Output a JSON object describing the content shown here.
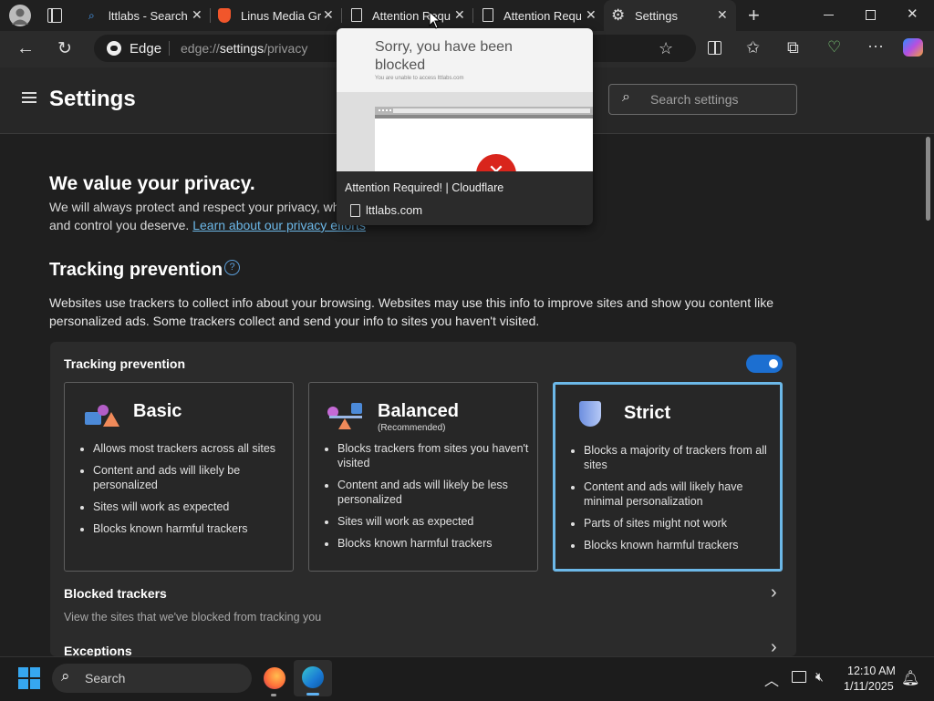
{
  "tabs": [
    {
      "title": "lttlabs - Search",
      "icon": "bing-search-icon"
    },
    {
      "title": "Linus Media Gr",
      "icon": "brave-lion-icon"
    },
    {
      "title": "Attention Requ",
      "icon": "page-icon"
    },
    {
      "title": "Attention Requ",
      "icon": "page-icon"
    },
    {
      "title": "Settings",
      "icon": "gear-icon"
    }
  ],
  "toolbar": {
    "browser_label": "Edge",
    "url_prefix": "edge://",
    "url_path": "settings",
    "url_suffix": "/privacy"
  },
  "settings": {
    "title": "Settings",
    "search_placeholder": "Search settings"
  },
  "privacy": {
    "heading": "We value your privacy.",
    "body_line1": "We will always protect and respect your privacy, wh",
    "body_line2": "and control you deserve.",
    "link": "Learn about our privacy efforts"
  },
  "tracking": {
    "heading": "Tracking prevention",
    "description_line1": "Websites use trackers to collect info about your browsing. Websites may use this info to improve sites and show you content like",
    "description_line2": "personalized ads. Some trackers collect and send your info to sites you haven't visited.",
    "card_label": "Tracking prevention",
    "toggle_on": true,
    "options": [
      {
        "name": "Basic",
        "subtitle": "",
        "bullets": [
          "Allows most trackers across all sites",
          "Content and ads will likely be personalized",
          "Sites will work as expected",
          "Blocks known harmful trackers"
        ]
      },
      {
        "name": "Balanced",
        "subtitle": "(Recommended)",
        "bullets": [
          "Blocks trackers from sites you haven't visited",
          "Content and ads will likely be less personalized",
          "Sites will work as expected",
          "Blocks known harmful trackers"
        ]
      },
      {
        "name": "Strict",
        "subtitle": "",
        "bullets": [
          "Blocks a majority of trackers from all sites",
          "Content and ads will likely have minimal personalization",
          "Parts of sites might not work",
          "Blocks known harmful trackers"
        ]
      }
    ],
    "selected": "Strict",
    "blocked_title": "Blocked trackers",
    "blocked_desc": "View the sites that we've blocked from tracking you",
    "exceptions_title": "Exceptions"
  },
  "tooltip": {
    "thumb_title_line1": "Sorry, you have been",
    "thumb_title_line2": "blocked",
    "thumb_sub": "You are unable to access lttlabs.com",
    "page_title": "Attention Required! | Cloudflare",
    "domain": "lttlabs.com"
  },
  "taskbar": {
    "search_placeholder": "Search",
    "time": "12:10 AM",
    "date": "1/11/2025"
  },
  "colors": {
    "accent": "#1c6fd1",
    "selected_border": "#6cb8e8",
    "link": "#6cb8e8"
  }
}
